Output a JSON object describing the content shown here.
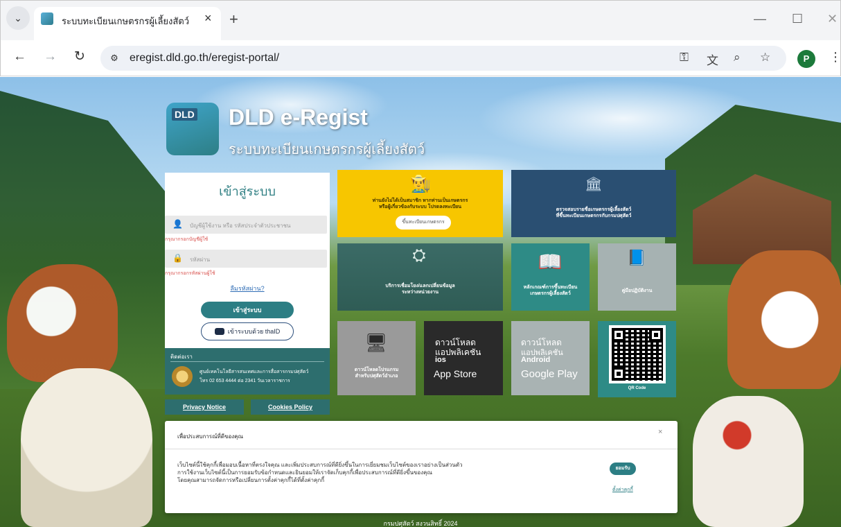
{
  "browser": {
    "tab_title": "ระบบทะเบียนเกษตรกรผู้เลี้ยงสัตว์",
    "url": "eregist.dld.go.th/eregist-portal/",
    "avatar_letter": "P",
    "icons": {
      "tab_list": "chevron-down",
      "close_tab": "close",
      "new_tab": "plus",
      "back": "arrow-left",
      "forward": "arrow-right",
      "reload": "reload",
      "site_info": "tune",
      "password_key": "key",
      "translate": "translate",
      "zoom": "zoom",
      "bookmark": "star",
      "menu": "kebab"
    }
  },
  "logo": {
    "badge": "DLD",
    "title": "DLD e-Regist",
    "subtitle": "ระบบทะเบียนเกษตรกรผู้เลี้ยงสัตว์"
  },
  "login": {
    "title": "เข้าสู่ระบบ",
    "username_placeholder": "บัญชีผู้ใช้งาน หรือ รหัสประจำตัวประชาชน",
    "username_error": "กรุณากรอกบัญชีผู้ใช้",
    "password_placeholder": "รหัสผ่าน",
    "password_error": "กรุณากรอกรหัสผ่านผู้ใช้",
    "forgot": "ลืมรหัสผ่าน?",
    "submit": "เข้าสู่ระบบ",
    "thaid": "เข้าระบบด้วย thaID"
  },
  "contact": {
    "title": "ติดต่อเรา",
    "org": "ศูนย์เทคโนโลยีสารสนเทศและการสื่อสารกรมปศุสัตว์",
    "phone": "โทร 02 653 4444 ต่อ 2341 วันเวลาราชการ"
  },
  "policy": {
    "privacy": "Privacy Notice",
    "cookies": "Cookies Policy"
  },
  "tiles": {
    "register": {
      "line1": "ท่านยังไม่ได้เป็นสมาชิก หากท่านเป็นเกษตรกร",
      "line2": "หรือผู้เกี่ยวข้องกับระบบ โปรดลงทะเบียน",
      "button": "ขึ้นทะเบียนเกษตรกร",
      "color": "#f7c600"
    },
    "check": {
      "line1": "ตรวจสอบรายชื่อเกษตรกรผู้เลี้ยงสัตว์",
      "line2": "ที่ขึ้นทะเบียนเกษตรกรกับกรมปศุสัตว์",
      "color": "#2a4f72"
    },
    "exchange": {
      "line1": "บริการเชื่อมโยง/แลกเปลี่ยนข้อมูล",
      "line2": "ระหว่างหน่วยงาน"
    },
    "criteria": {
      "line1": "หลักเกณฑ์การขึ้นทะเบียน",
      "line2": "เกษตรกรผู้เลี้ยงสัตว์",
      "color": "#2e8b86"
    },
    "manual": {
      "label": "คู่มือปฏิบัติงาน"
    },
    "program": {
      "line1": "ดาวน์โหลดโปรแกรม",
      "line2": "สำหรับปศุสัตว์อำเภอ"
    },
    "ios": {
      "line1": "ดาวน์โหลด",
      "line2": "แอปพลิเคชัน",
      "line3": "ios",
      "store": "App Store"
    },
    "android": {
      "line1": "ดาวน์โหลด",
      "line2": "แอปพลิเคชัน",
      "line3": "Android",
      "store": "Google Play"
    },
    "qr": {
      "label": "QR Code"
    }
  },
  "cookie_banner": {
    "title": "เพื่อประสบการณ์ที่ดีของคุณ",
    "close": "×",
    "text_line1": "เว็บไซต์นี้ใช้คุกกี้เพื่อมอบเนื้อหาที่ตรงใจคุณ และเพิ่มประสบการณ์ที่ดียิ่งขึ้นในการเยี่ยมชมเว็บไซต์ของเราอย่างเป็นส่วนตัว",
    "text_line2": "การใช้งานเว็บไซต์นี้เป็นการยอมรับข้อกำหนดและยินยอมให้เราจัดเก็บคุกกี้เพื่อประสบการณ์ที่ดียิ่งขึ้นของคุณ",
    "text_line3": "โดยคุณสามารถจัดการหรือเปลี่ยนการตั้งค่าคุกกี้ได้ที่ตั้งค่าคุกกี้",
    "accept": "ยอมรับ",
    "settings": "ตั้งค่าคุกกี้"
  },
  "footer": "กรมปศุสัตว์ สงวนสิทธิ์ 2024"
}
